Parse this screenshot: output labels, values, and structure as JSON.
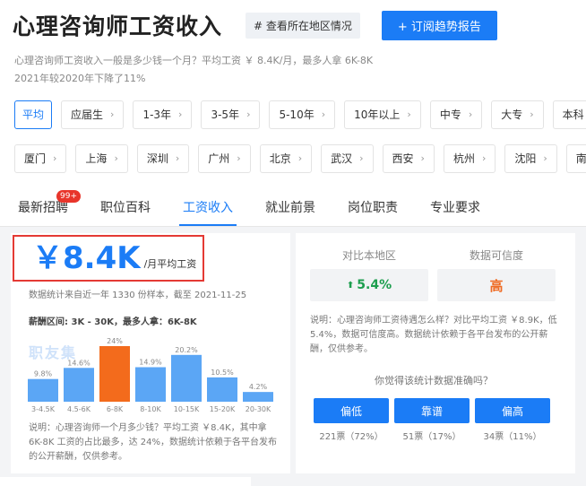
{
  "header": {
    "title": "心理咨询师工资收入",
    "region_button": "# 查看所在地区情况",
    "subscribe_button": "+ 订阅趋势报告"
  },
  "description": {
    "line1": "心理咨询师工资收入一般是多少钱一个月？平均工资 ￥ 8.4K/月，最多人拿 6K-8K",
    "line2": "2021年较2020年下降了11%"
  },
  "experience_filters": [
    "平均",
    "应届生",
    "1-3年",
    "3-5年",
    "5-10年",
    "10年以上",
    "中专",
    "大专",
    "本科"
  ],
  "city_filters": [
    "厦门",
    "上海",
    "深圳",
    "广州",
    "北京",
    "武汉",
    "西安",
    "杭州",
    "沈阳",
    "南"
  ],
  "chevron": "›",
  "tabs": [
    {
      "label": "最新招聘",
      "badge": "99+"
    },
    {
      "label": "职位百科"
    },
    {
      "label": "工资收入"
    },
    {
      "label": "就业前景"
    },
    {
      "label": "岗位职责"
    },
    {
      "label": "专业要求"
    }
  ],
  "salary": {
    "value": "￥8.4K",
    "unit": "/月平均工资",
    "stats_note": "数据统计来自近一年 1330 份样本，截至 2021-11-25",
    "range_line": "薪酬区间: 3K - 30K，最多人拿：6K-8K",
    "watermark": "职友集",
    "note": "说明：心理咨询师一个月多少钱？平均工资 ￥8.4K，其中拿 6K-8K 工资的占比最多，达 24%，数据统计依赖于各平台发布的公开薪酬，仅供参考。"
  },
  "chart_data": {
    "type": "bar",
    "categories": [
      "3-4.5K",
      "4.5-6K",
      "6-8K",
      "8-10K",
      "10-15K",
      "15-20K",
      "20-30K"
    ],
    "values": [
      9.8,
      14.6,
      24,
      14.9,
      20.2,
      10.5,
      4.2
    ],
    "value_labels": [
      "9.8%",
      "14.6%",
      "24%",
      "14.9%",
      "20.2%",
      "10.5%",
      "4.2%"
    ],
    "highlight_index": 2,
    "colors": {
      "normal": "#5ba6f5",
      "highlight": "#f36b1c",
      "label": "#888888"
    },
    "title": "",
    "xlabel": "",
    "ylabel": "",
    "ylim": [
      0,
      24
    ]
  },
  "comparison": {
    "local_label": "对比本地区",
    "local_value": "5.4%",
    "local_arrow": "⬆",
    "reliability_label": "数据可信度",
    "reliability_value": "高",
    "note": "说明：心理咨询师工资待遇怎么样？对比平均工资 ￥8.9K，低 5.4%，数据可信度高。数据统计依赖于各平台发布的公开薪酬，仅供参考。",
    "question": "你觉得该统计数据准确吗？",
    "votes": [
      {
        "label": "偏低",
        "count": "221票（72%）"
      },
      {
        "label": "靠谱",
        "count": "51票（17%）"
      },
      {
        "label": "偏高",
        "count": "34票（11%）"
      }
    ]
  },
  "colors": {
    "accent": "#1b7cf6",
    "highlight": "#e43a34",
    "orange": "#ef6b24",
    "green": "#1d9e4e"
  }
}
